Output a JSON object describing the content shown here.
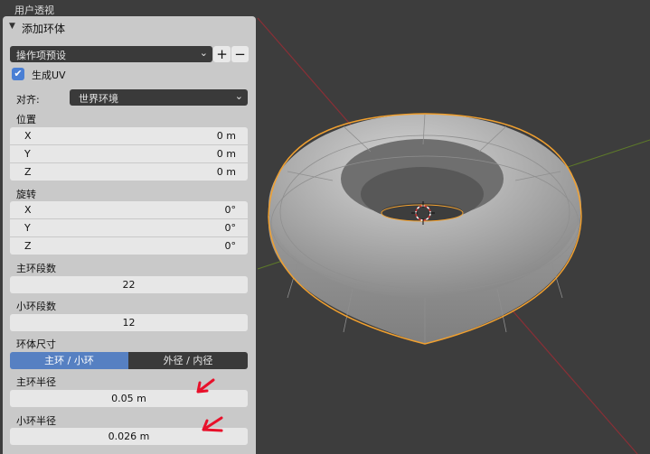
{
  "viewport": {
    "mode_label": "用户透视"
  },
  "panel": {
    "title": "添加环体",
    "preset": {
      "value": "操作项预设",
      "add_label": "+",
      "remove_label": "−"
    },
    "generate_uv": {
      "label": "生成UV",
      "checked": true
    },
    "align": {
      "label": "对齐:",
      "value": "世界环境"
    },
    "location": {
      "label": "位置",
      "rows": [
        {
          "axis": "X",
          "value": "0 m"
        },
        {
          "axis": "Y",
          "value": "0 m"
        },
        {
          "axis": "Z",
          "value": "0 m"
        }
      ]
    },
    "rotation": {
      "label": "旋转",
      "rows": [
        {
          "axis": "X",
          "value": "0°"
        },
        {
          "axis": "Y",
          "value": "0°"
        },
        {
          "axis": "Z",
          "value": "0°"
        }
      ]
    },
    "major_segments": {
      "label": "主环段数",
      "value": "22"
    },
    "minor_segments": {
      "label": "小环段数",
      "value": "12"
    },
    "dimensions_mode": {
      "label": "环体尺寸",
      "options": [
        "主环 / 小环",
        "外径 / 内径"
      ],
      "selected": 0
    },
    "major_radius": {
      "label": "主环半径",
      "value": "0.05 m"
    },
    "minor_radius": {
      "label": "小环半径",
      "value": "0.026 m"
    }
  },
  "colors": {
    "selection_outline": "#f0a030",
    "checkbox": "#4a7fd4",
    "annotation_arrow": "#e8102a"
  }
}
